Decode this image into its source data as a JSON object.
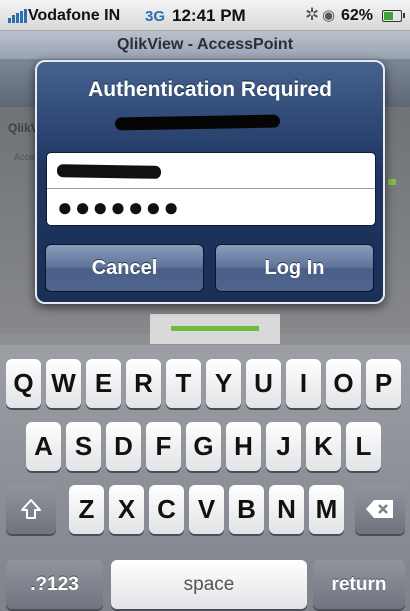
{
  "status_bar": {
    "carrier": "Vodafone IN",
    "network": "3G",
    "time": "12:41 PM",
    "battery_percent": "62%",
    "battery_level": 0.62
  },
  "browser": {
    "title": "QlikView - AccessPoint"
  },
  "background_page": {
    "logo_text": "QlikView",
    "sub_text": "AccessPoint"
  },
  "alert": {
    "title": "Authentication Required",
    "password_mask": "●●●●●●●",
    "cancel_label": "Cancel",
    "login_label": "Log In"
  },
  "keyboard": {
    "row1": [
      "Q",
      "W",
      "E",
      "R",
      "T",
      "Y",
      "U",
      "I",
      "O",
      "P"
    ],
    "row2": [
      "A",
      "S",
      "D",
      "F",
      "G",
      "H",
      "J",
      "K",
      "L"
    ],
    "row3": [
      "Z",
      "X",
      "C",
      "V",
      "B",
      "N",
      "M"
    ],
    "shift_icon": "shift-arrow-icon",
    "delete_icon": "backspace-icon",
    "numbers_label": ".?123",
    "space_label": "space",
    "return_label": "return"
  },
  "colors": {
    "alert_blue": "#1e3561",
    "accent_blue": "#2d6fb3",
    "battery_green": "#3aa53a",
    "progress_green": "#6ebc3e"
  }
}
